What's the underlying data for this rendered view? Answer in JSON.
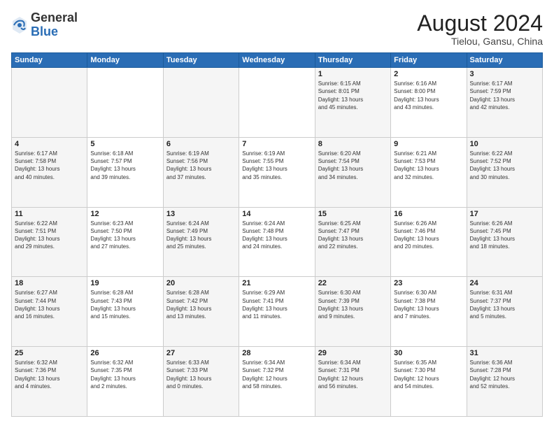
{
  "header": {
    "logo_general": "General",
    "logo_blue": "Blue",
    "month": "August 2024",
    "location": "Tielou, Gansu, China"
  },
  "weekdays": [
    "Sunday",
    "Monday",
    "Tuesday",
    "Wednesday",
    "Thursday",
    "Friday",
    "Saturday"
  ],
  "weeks": [
    [
      {
        "day": "",
        "info": ""
      },
      {
        "day": "",
        "info": ""
      },
      {
        "day": "",
        "info": ""
      },
      {
        "day": "",
        "info": ""
      },
      {
        "day": "1",
        "info": "Sunrise: 6:15 AM\nSunset: 8:01 PM\nDaylight: 13 hours\nand 45 minutes."
      },
      {
        "day": "2",
        "info": "Sunrise: 6:16 AM\nSunset: 8:00 PM\nDaylight: 13 hours\nand 43 minutes."
      },
      {
        "day": "3",
        "info": "Sunrise: 6:17 AM\nSunset: 7:59 PM\nDaylight: 13 hours\nand 42 minutes."
      }
    ],
    [
      {
        "day": "4",
        "info": "Sunrise: 6:17 AM\nSunset: 7:58 PM\nDaylight: 13 hours\nand 40 minutes."
      },
      {
        "day": "5",
        "info": "Sunrise: 6:18 AM\nSunset: 7:57 PM\nDaylight: 13 hours\nand 39 minutes."
      },
      {
        "day": "6",
        "info": "Sunrise: 6:19 AM\nSunset: 7:56 PM\nDaylight: 13 hours\nand 37 minutes."
      },
      {
        "day": "7",
        "info": "Sunrise: 6:19 AM\nSunset: 7:55 PM\nDaylight: 13 hours\nand 35 minutes."
      },
      {
        "day": "8",
        "info": "Sunrise: 6:20 AM\nSunset: 7:54 PM\nDaylight: 13 hours\nand 34 minutes."
      },
      {
        "day": "9",
        "info": "Sunrise: 6:21 AM\nSunset: 7:53 PM\nDaylight: 13 hours\nand 32 minutes."
      },
      {
        "day": "10",
        "info": "Sunrise: 6:22 AM\nSunset: 7:52 PM\nDaylight: 13 hours\nand 30 minutes."
      }
    ],
    [
      {
        "day": "11",
        "info": "Sunrise: 6:22 AM\nSunset: 7:51 PM\nDaylight: 13 hours\nand 29 minutes."
      },
      {
        "day": "12",
        "info": "Sunrise: 6:23 AM\nSunset: 7:50 PM\nDaylight: 13 hours\nand 27 minutes."
      },
      {
        "day": "13",
        "info": "Sunrise: 6:24 AM\nSunset: 7:49 PM\nDaylight: 13 hours\nand 25 minutes."
      },
      {
        "day": "14",
        "info": "Sunrise: 6:24 AM\nSunset: 7:48 PM\nDaylight: 13 hours\nand 24 minutes."
      },
      {
        "day": "15",
        "info": "Sunrise: 6:25 AM\nSunset: 7:47 PM\nDaylight: 13 hours\nand 22 minutes."
      },
      {
        "day": "16",
        "info": "Sunrise: 6:26 AM\nSunset: 7:46 PM\nDaylight: 13 hours\nand 20 minutes."
      },
      {
        "day": "17",
        "info": "Sunrise: 6:26 AM\nSunset: 7:45 PM\nDaylight: 13 hours\nand 18 minutes."
      }
    ],
    [
      {
        "day": "18",
        "info": "Sunrise: 6:27 AM\nSunset: 7:44 PM\nDaylight: 13 hours\nand 16 minutes."
      },
      {
        "day": "19",
        "info": "Sunrise: 6:28 AM\nSunset: 7:43 PM\nDaylight: 13 hours\nand 15 minutes."
      },
      {
        "day": "20",
        "info": "Sunrise: 6:28 AM\nSunset: 7:42 PM\nDaylight: 13 hours\nand 13 minutes."
      },
      {
        "day": "21",
        "info": "Sunrise: 6:29 AM\nSunset: 7:41 PM\nDaylight: 13 hours\nand 11 minutes."
      },
      {
        "day": "22",
        "info": "Sunrise: 6:30 AM\nSunset: 7:39 PM\nDaylight: 13 hours\nand 9 minutes."
      },
      {
        "day": "23",
        "info": "Sunrise: 6:30 AM\nSunset: 7:38 PM\nDaylight: 13 hours\nand 7 minutes."
      },
      {
        "day": "24",
        "info": "Sunrise: 6:31 AM\nSunset: 7:37 PM\nDaylight: 13 hours\nand 5 minutes."
      }
    ],
    [
      {
        "day": "25",
        "info": "Sunrise: 6:32 AM\nSunset: 7:36 PM\nDaylight: 13 hours\nand 4 minutes."
      },
      {
        "day": "26",
        "info": "Sunrise: 6:32 AM\nSunset: 7:35 PM\nDaylight: 13 hours\nand 2 minutes."
      },
      {
        "day": "27",
        "info": "Sunrise: 6:33 AM\nSunset: 7:33 PM\nDaylight: 13 hours\nand 0 minutes."
      },
      {
        "day": "28",
        "info": "Sunrise: 6:34 AM\nSunset: 7:32 PM\nDaylight: 12 hours\nand 58 minutes."
      },
      {
        "day": "29",
        "info": "Sunrise: 6:34 AM\nSunset: 7:31 PM\nDaylight: 12 hours\nand 56 minutes."
      },
      {
        "day": "30",
        "info": "Sunrise: 6:35 AM\nSunset: 7:30 PM\nDaylight: 12 hours\nand 54 minutes."
      },
      {
        "day": "31",
        "info": "Sunrise: 6:36 AM\nSunset: 7:28 PM\nDaylight: 12 hours\nand 52 minutes."
      }
    ]
  ]
}
